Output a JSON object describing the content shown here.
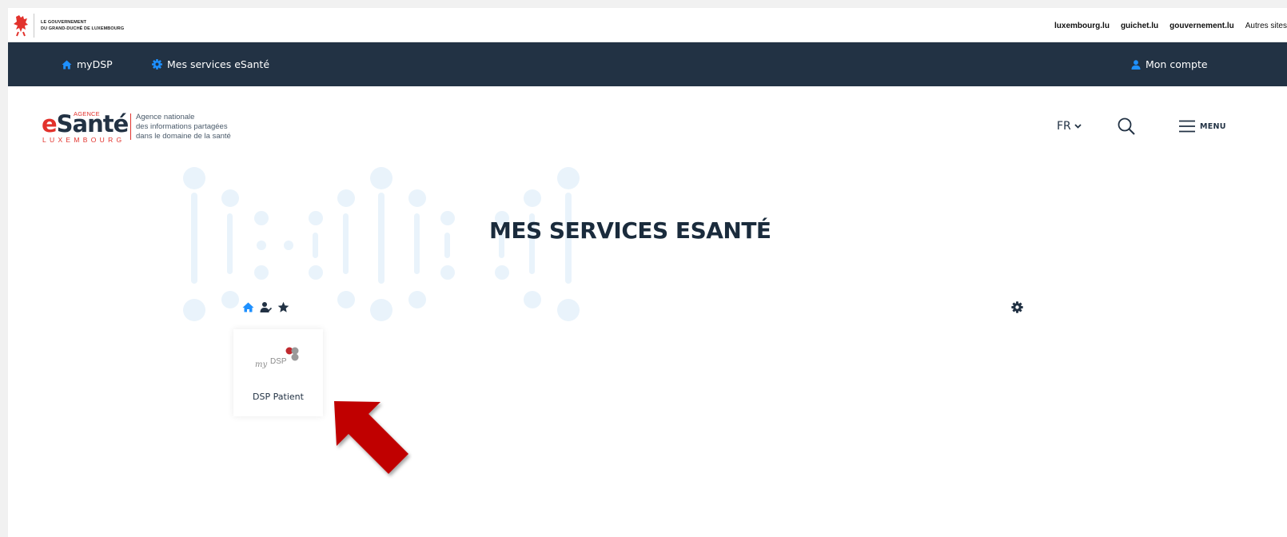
{
  "gov_bar": {
    "name_line1": "LE GOUVERNEMENT",
    "name_line2": "DU GRAND-DUCHÉ DE LUXEMBOURG",
    "links": [
      "luxembourg.lu",
      "guichet.lu",
      "gouvernement.lu"
    ],
    "other_sites": "Autres sites"
  },
  "nav": {
    "home_label": "myDSP",
    "services_label": "Mes services eSanté",
    "account_label": "Mon compte"
  },
  "logo": {
    "agence": "AGENCE",
    "word_e": "e",
    "word_rest": "Santé",
    "country": "LUXEMBOURG",
    "desc_line1": "Agence nationale",
    "desc_line2": "des informations partagées",
    "desc_line3": "dans le domaine de la santé"
  },
  "header": {
    "lang": "FR",
    "menu_label": "MENU"
  },
  "main": {
    "title": "MES SERVICES ESANTÉ",
    "cards": [
      {
        "logo_text_my": "my",
        "logo_text_dsp": "DSP",
        "label": "DSP Patient"
      }
    ]
  },
  "colors": {
    "navy": "#223244",
    "accent_blue": "#1e90ff",
    "brand_red": "#e2322c",
    "arrow_red": "#c00000",
    "pattern": "#e9f3fb"
  },
  "icons": [
    "home-icon",
    "gear-icon",
    "user-icon",
    "chevron-down-icon",
    "search-icon",
    "hamburger-icon",
    "user-group-icon",
    "star-icon",
    "settings-icon",
    "arrow-pointer-icon"
  ]
}
